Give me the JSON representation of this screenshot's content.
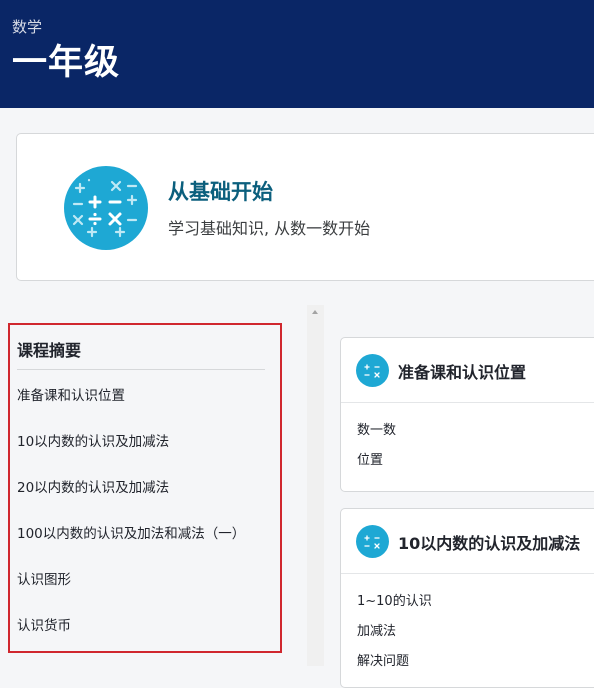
{
  "header": {
    "subject": "数学",
    "grade": "一年级"
  },
  "intro": {
    "title": "从基础开始",
    "description": "学习基础知识, 从数一数开始"
  },
  "summary": {
    "title": "课程摘要",
    "items": [
      "准备课和认识位置",
      "10以内数的认识及加减法",
      "20以内数的认识及加减法",
      "100以内数的认识及加法和减法（一）",
      "认识图形",
      "认识货币"
    ]
  },
  "units": [
    {
      "title": "准备课和认识位置",
      "lessons": [
        "数一数",
        "位置"
      ]
    },
    {
      "title": "10以内数的认识及加减法",
      "lessons": [
        "1~10的认识",
        "加减法",
        "解决问题"
      ]
    }
  ],
  "colors": {
    "header_bg": "#0a2666",
    "accent_teal": "#1ea8d4",
    "intro_title": "#0b5f7d",
    "highlight_border": "#d0272e"
  },
  "icons": {
    "intro_badge": "math-symbols-icon",
    "unit_icon": "math-symbols-icon"
  }
}
